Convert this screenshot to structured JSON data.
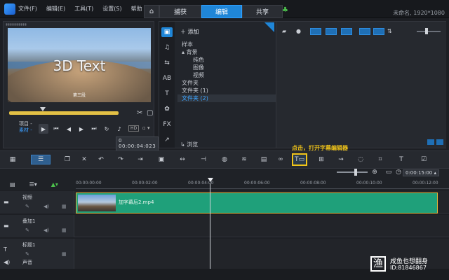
{
  "menu": [
    "文件(F)",
    "编辑(E)",
    "工具(T)",
    "设置(S)",
    "帮助"
  ],
  "tabs": {
    "home": "⌂",
    "capture": "捕获",
    "edit": "编辑",
    "share": "共享"
  },
  "project": "未命名, 1920*1080",
  "preview": {
    "title_text": "3D Text",
    "subtitle_text": "第三段",
    "mode_project": "项目 -",
    "mode_clip": "素材 -",
    "hd": "HD",
    "ratio": "▫ ▾",
    "timecode": "0 00:00:04:023 ▴"
  },
  "library": {
    "add": "添加",
    "tree": [
      "样本",
      "背景",
      "纯色",
      "图像",
      "视频",
      "文件夹",
      "文件夹 (1)",
      "文件夹 (2)"
    ],
    "browse": "浏览"
  },
  "annotation": "点击，打开字幕编辑器",
  "timeline": {
    "timecode": "0:00:15:00 ▴",
    "ruler": [
      "00:00:00:00",
      "00:00:02:00",
      "00:00:04:00",
      "00:00:06:00",
      "00:00:08:00",
      "00:00:10:00",
      "00:00:12:00"
    ],
    "tracks": [
      {
        "name": "视频",
        "clip": "加字幕后2.mp4"
      },
      {
        "name": "叠加1"
      },
      {
        "name": "标题1"
      },
      {
        "name": "声音"
      }
    ]
  },
  "watermark": {
    "line1": "咸鱼也想翻身",
    "line2": "ID:81846867"
  },
  "colors": {
    "accent": "#1f86d8",
    "clip": "#1fa07a",
    "highlight": "#f0c419"
  }
}
